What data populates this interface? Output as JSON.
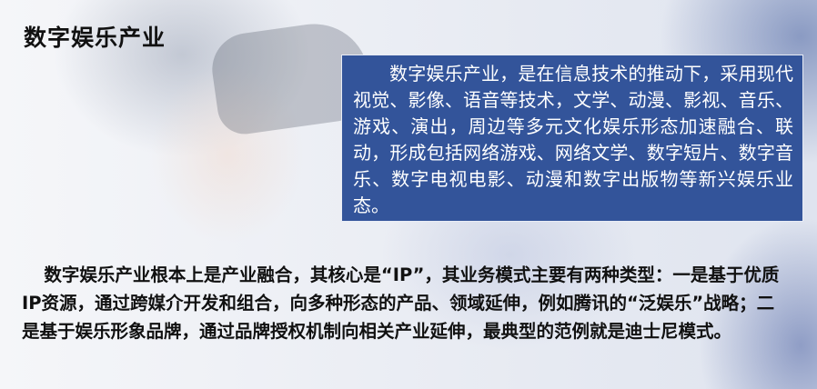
{
  "slide": {
    "title": "数字娱乐产业",
    "definition": "数字娱乐产业，是在信息技术的推动下，采用现代视觉、影像、语音等技术，文学、动漫、影视、音乐、游戏、演出，周边等多元文化娱乐形态加速融合、联动，形成包括网络游戏、网络文学、数字短片、数字音乐、数字电视电影、动漫和数字出版物等新兴娱乐业态。",
    "body": "数字娱乐产业根本上是产业融合，其核心是“IP”，其业务模式主要有两种类型：一是基于优质IP资源，通过跨媒介开发和组合，向多种形态的产品、领域延伸，例如腾讯的“泛娱乐”战略；二是基于娱乐形象品牌，通过品牌授权机制向相关产业延伸，最典型的范例就是迪士尼模式。"
  }
}
